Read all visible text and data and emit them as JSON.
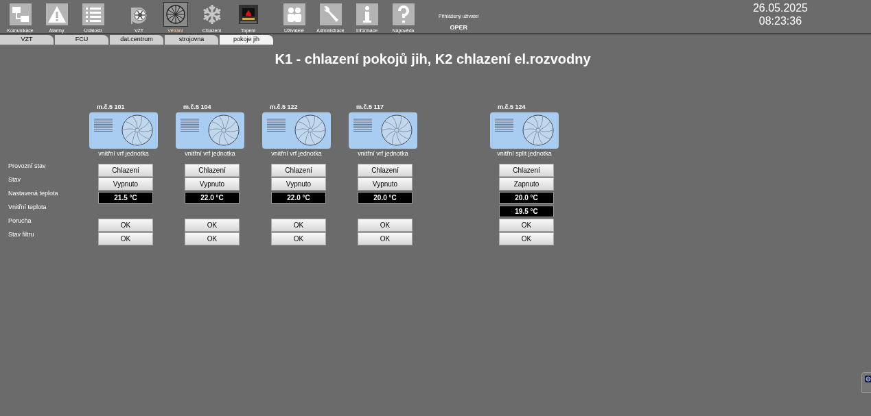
{
  "toolbar": {
    "groups": [
      [
        {
          "label": "Komunikace",
          "kind": "network",
          "selected": false
        },
        {
          "label": "Alarmy",
          "kind": "alarm",
          "selected": false
        },
        {
          "label": "Události",
          "kind": "list",
          "selected": false
        }
      ],
      [
        {
          "label": "VZT",
          "kind": "blower",
          "selected": false
        },
        {
          "label": "Větrání",
          "kind": "fan",
          "selected": true
        },
        {
          "label": "Chlazení",
          "kind": "snow",
          "selected": false
        },
        {
          "label": "Topení",
          "kind": "fire",
          "selected": false
        }
      ],
      [
        {
          "label": "Uživatelé",
          "kind": "users",
          "selected": false
        },
        {
          "label": "Administrace",
          "kind": "wrench",
          "selected": false
        },
        {
          "label": "Informace",
          "kind": "info",
          "selected": false
        },
        {
          "label": "Nápověda",
          "kind": "help",
          "selected": false
        }
      ]
    ]
  },
  "user": {
    "caption": "Přihlášený uživatel",
    "name": "OPER"
  },
  "clock": {
    "date": "26.05.2025",
    "time": "08:23:36"
  },
  "tabs": [
    {
      "label": "VZT",
      "selected": false
    },
    {
      "label": "FCU",
      "selected": false
    },
    {
      "label": "dat.centrum",
      "selected": false
    },
    {
      "label": "strojovna",
      "selected": false
    },
    {
      "label": "pokoje jih",
      "selected": true
    }
  ],
  "title": "K1 - chlazení pokojů jih, K2 chlazení el.rozvodny",
  "row_labels": [
    "Provozní stav",
    "Stav",
    "Nastavená teplota",
    "Vnitřní teplota",
    "Porucha",
    "Stav filtru"
  ],
  "unit_groups": [
    [
      {
        "room": "m.č.5 101",
        "caption": "vnitřní vrf jednotka",
        "values": [
          {
            "kind": "button",
            "text": "Chlazení"
          },
          {
            "kind": "button",
            "text": "Vypnuto"
          },
          {
            "kind": "display",
            "text": "21.5 °C"
          },
          {
            "kind": "none"
          },
          {
            "kind": "button",
            "text": "OK"
          },
          {
            "kind": "button",
            "text": "OK"
          }
        ]
      },
      {
        "room": "m.č.5 104",
        "caption": "vnitřní vrf jednotka",
        "values": [
          {
            "kind": "button",
            "text": "Chlazení"
          },
          {
            "kind": "button",
            "text": "Vypnuto"
          },
          {
            "kind": "display",
            "text": "22.0 °C"
          },
          {
            "kind": "none"
          },
          {
            "kind": "button",
            "text": "OK"
          },
          {
            "kind": "button",
            "text": "OK"
          }
        ]
      },
      {
        "room": "m.č.5 122",
        "caption": "vnitřní vrf jednotka",
        "values": [
          {
            "kind": "button",
            "text": "Chlazení"
          },
          {
            "kind": "button",
            "text": "Vypnuto"
          },
          {
            "kind": "display",
            "text": "22.0 °C"
          },
          {
            "kind": "none"
          },
          {
            "kind": "button",
            "text": "OK"
          },
          {
            "kind": "button",
            "text": "OK"
          }
        ]
      },
      {
        "room": "m.č.5 117",
        "caption": "vnitřní vrf jednotka",
        "values": [
          {
            "kind": "button",
            "text": "Chlazení"
          },
          {
            "kind": "button",
            "text": "Vypnuto"
          },
          {
            "kind": "display",
            "text": "20.0 °C"
          },
          {
            "kind": "none"
          },
          {
            "kind": "button",
            "text": "OK"
          },
          {
            "kind": "button",
            "text": "OK"
          }
        ]
      }
    ],
    [
      {
        "room": "m.č.5 124",
        "caption": "vnitřní split jednotka",
        "values": [
          {
            "kind": "button",
            "text": "Chlazení"
          },
          {
            "kind": "button",
            "text": "Zapnuto"
          },
          {
            "kind": "display",
            "text": "20.0 °C"
          },
          {
            "kind": "display",
            "text": "19.5 °C"
          },
          {
            "kind": "button",
            "text": "OK"
          },
          {
            "kind": "button",
            "text": "OK"
          }
        ]
      }
    ]
  ]
}
